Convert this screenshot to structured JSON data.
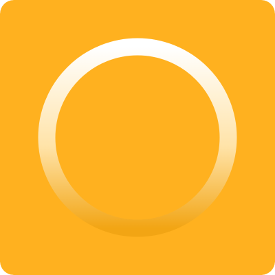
{
  "tile": {
    "icon": "ring-icon",
    "colors": {
      "background": "#FFB11F",
      "ring_top": "#FFFFFF",
      "ring_mid": "#FFE3A8",
      "ring_bottom": "#F2A514"
    }
  }
}
